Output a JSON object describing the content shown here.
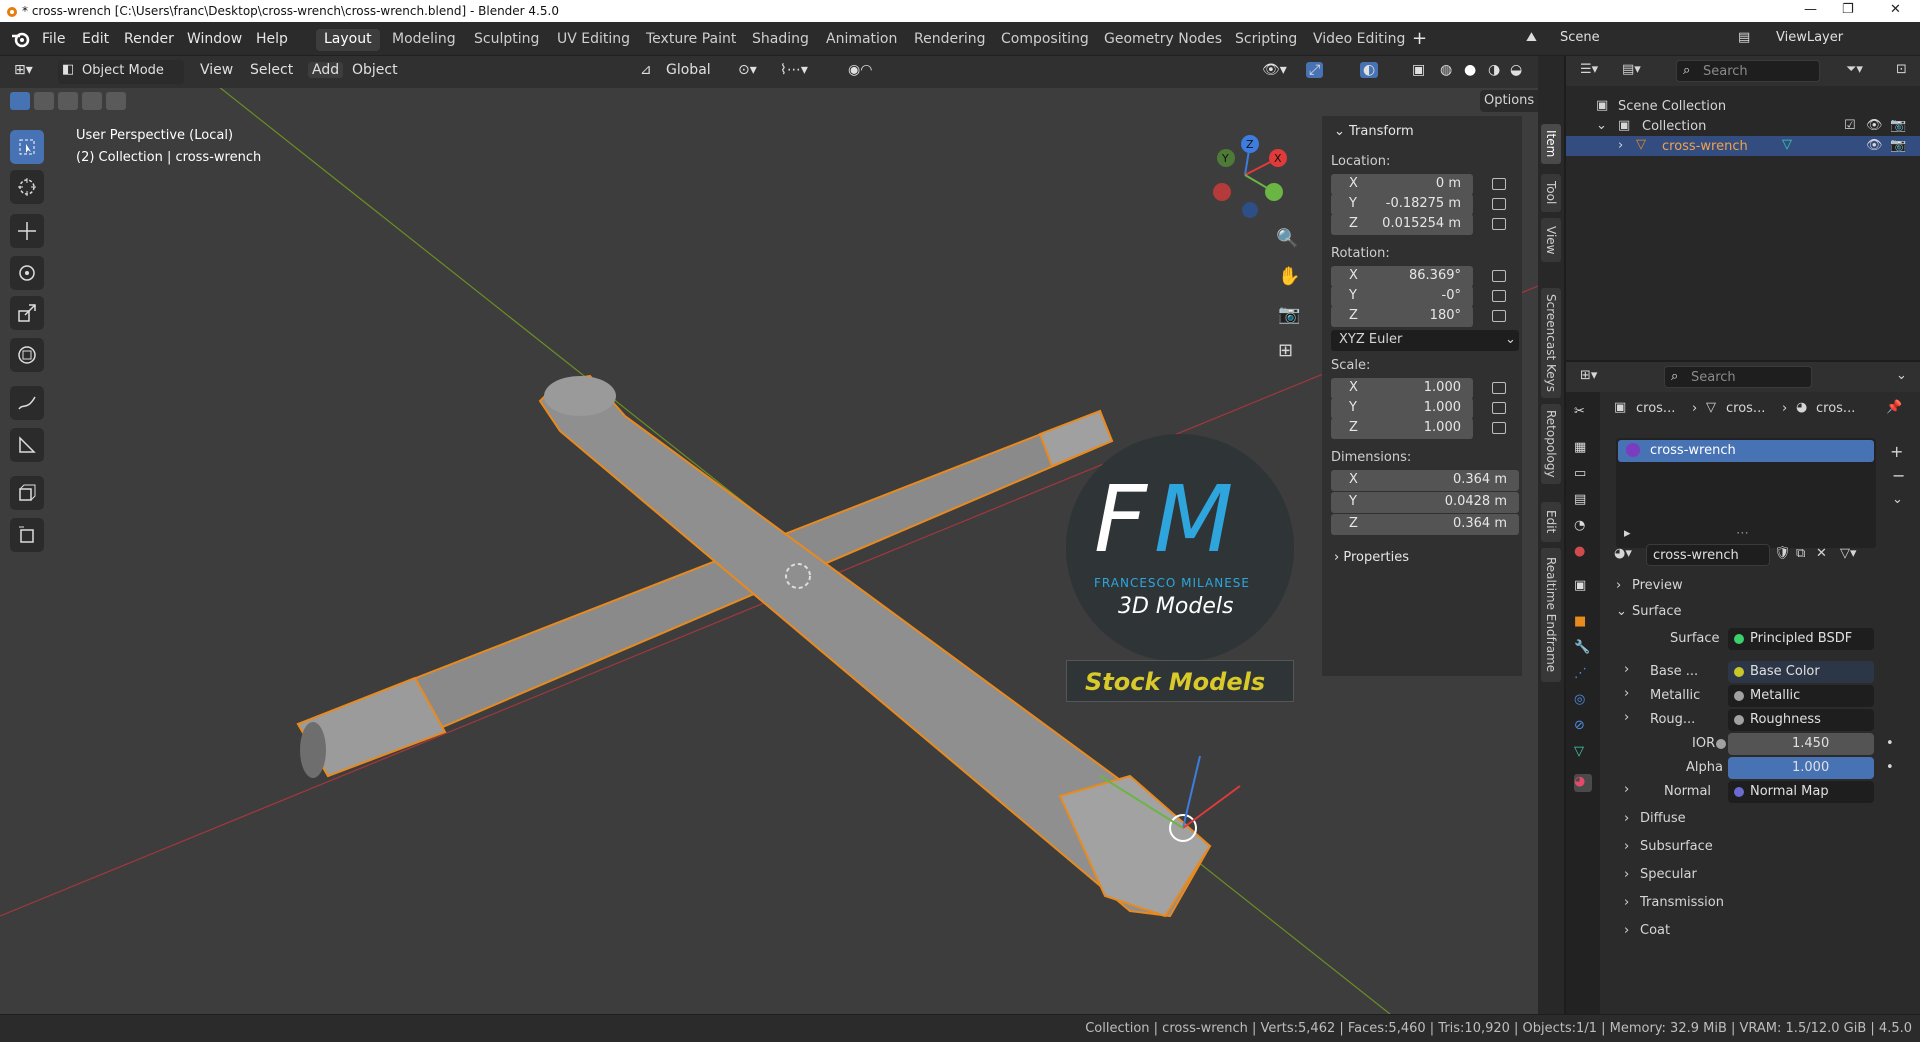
{
  "titlebar": {
    "title": "* cross-wrench [C:\\Users\\franc\\Desktop\\cross-wrench\\cross-wrench.blend] - Blender 4.5.0"
  },
  "menubar": {
    "items": [
      "File",
      "Edit",
      "Render",
      "Window",
      "Help"
    ],
    "workspaces": [
      "Layout",
      "Modeling",
      "Sculpting",
      "UV Editing",
      "Texture Paint",
      "Shading",
      "Animation",
      "Rendering",
      "Compositing",
      "Geometry Nodes",
      "Scripting",
      "Video Editing"
    ],
    "scene": "Scene",
    "view_layer": "ViewLayer"
  },
  "viewport": {
    "header": {
      "mode": "Object Mode",
      "menus": [
        "View",
        "Select",
        "Add",
        "Object"
      ],
      "orientation": "Global",
      "options": "Options"
    },
    "overlay_text": {
      "line1": "User Perspective (Local)",
      "line2": "(2) Collection | cross-wrench"
    },
    "gizmo": {
      "x": "X",
      "y": "Y",
      "z": "Z"
    },
    "watermark": {
      "initials_f": "F",
      "initials_m": "M",
      "name": "FRANCESCO MILANESE",
      "sub": "3D Models",
      "banner": "Stock Models"
    }
  },
  "npanel": {
    "transform_title": "Transform",
    "location_label": "Location:",
    "location": [
      {
        "axis": "X",
        "value": "0 m"
      },
      {
        "axis": "Y",
        "value": "-0.18275 m"
      },
      {
        "axis": "Z",
        "value": "0.015254 m"
      }
    ],
    "rotation_label": "Rotation:",
    "rotation": [
      {
        "axis": "X",
        "value": "86.369°"
      },
      {
        "axis": "Y",
        "value": "-0°"
      },
      {
        "axis": "Z",
        "value": "180°"
      }
    ],
    "rotation_mode": "XYZ Euler",
    "scale_label": "Scale:",
    "scale": [
      {
        "axis": "X",
        "value": "1.000"
      },
      {
        "axis": "Y",
        "value": "1.000"
      },
      {
        "axis": "Z",
        "value": "1.000"
      }
    ],
    "dimensions_label": "Dimensions:",
    "dimensions": [
      {
        "axis": "X",
        "value": "0.364 m"
      },
      {
        "axis": "Y",
        "value": "0.0428 m"
      },
      {
        "axis": "Z",
        "value": "0.364 m"
      }
    ],
    "properties_title": "Properties"
  },
  "side_tabs": [
    "Item",
    "Tool",
    "View",
    "Screencast Keys",
    "Retopology",
    "Edit",
    "Realtime Endframe"
  ],
  "outliner": {
    "search_placeholder": "Search",
    "scene_collection": "Scene Collection",
    "collection": "Collection",
    "object": "cross-wrench"
  },
  "properties": {
    "search_placeholder": "Search",
    "breadcrumb": [
      "cros...",
      "cros...",
      "cros..."
    ],
    "material_slot": "cross-wrench",
    "material_name": "cross-wrench",
    "sections": {
      "preview": "Preview",
      "surface": "Surface"
    },
    "surface": {
      "label": "Surface",
      "value": "Principled BSDF"
    },
    "inputs": [
      {
        "label": "Base ...",
        "value": "Base Color",
        "dot": "#c7c729"
      },
      {
        "label": "Metallic",
        "value": "Metallic",
        "dot": "#a1a1a1"
      },
      {
        "label": "Roug...",
        "value": "Roughness",
        "dot": "#a1a1a1"
      }
    ],
    "ior": {
      "label": "IOR",
      "value": "1.450"
    },
    "alpha": {
      "label": "Alpha",
      "value": "1.000"
    },
    "normal": {
      "label": "Normal",
      "value": "Normal Map"
    },
    "collapsed": [
      "Diffuse",
      "Subsurface",
      "Specular",
      "Transmission",
      "Coat"
    ]
  },
  "statusbar": {
    "text": "Collection | cross-wrench | Verts:5,462 | Faces:5,460 | Tris:10,920 | Objects:1/1 | Memory: 32.9 MiB | VRAM: 1.5/12.0 GiB | 4.5.0"
  },
  "colors": {
    "accent": "#4772b3",
    "selection": "#e88a1e",
    "viewport_bg": "#3d3d3d",
    "alpha_bar": "#4772b3"
  }
}
